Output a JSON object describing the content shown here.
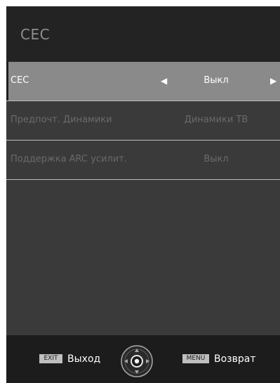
{
  "header": {
    "title": "CEC"
  },
  "rows": [
    {
      "label": "CEC",
      "value": "Выкл"
    },
    {
      "label": "Предпочт. Динамики",
      "value": "Динамики ТВ"
    },
    {
      "label": "Поддержка ARC усилит.",
      "value": "Выкл"
    }
  ],
  "footer": {
    "exit_key": "EXIT",
    "exit_label": "Выход",
    "menu_key": "MENU",
    "menu_label": "Возврат"
  },
  "icons": {
    "left_arrow": "arrow-left-icon",
    "right_arrow": "arrow-right-icon",
    "navigation": "dpad-icon"
  }
}
